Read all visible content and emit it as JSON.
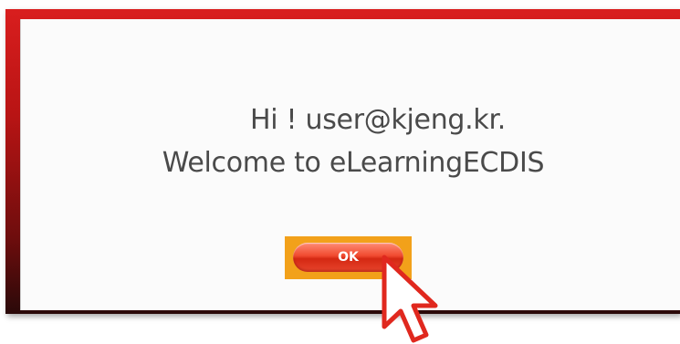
{
  "dialog": {
    "greeting": "Hi ! user@kjeng.kr.",
    "welcome": "Welcome to eLearningECDIS",
    "ok_label": "OK"
  },
  "colors": {
    "frame": "#c8181a",
    "highlight": "#f2a11a",
    "button": "#e0361c",
    "cursor_outline": "#e0281e"
  },
  "icons": {
    "cursor": "mouse-pointer-icon"
  }
}
